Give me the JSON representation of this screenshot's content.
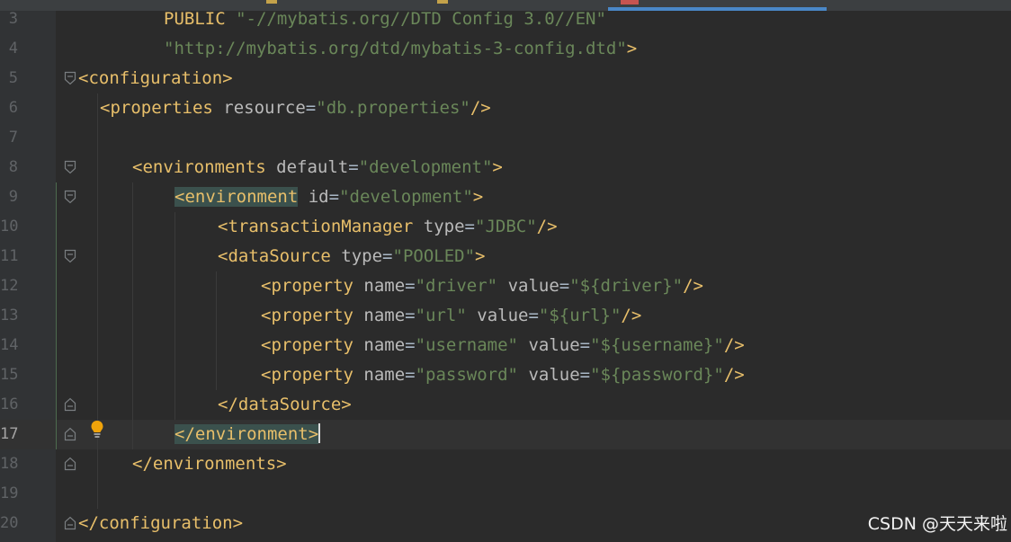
{
  "editor": {
    "current_line": 17,
    "lines": [
      {
        "num": "3",
        "tokens": [
          [
            "doc",
            "PUBLIC "
          ],
          [
            "str",
            "\"-//mybatis.org//DTD Config 3.0//EN\""
          ]
        ]
      },
      {
        "num": "4",
        "tokens": [
          [
            "str",
            "\"http://mybatis.org/dtd/mybatis-3-config.dtd\""
          ],
          [
            "tag",
            ">"
          ]
        ]
      },
      {
        "num": "5",
        "tokens": [
          [
            "tag",
            "<configuration>"
          ]
        ]
      },
      {
        "num": "6",
        "tokens": [
          [
            "tag",
            "<properties "
          ],
          [
            "attr",
            "resource"
          ],
          [
            "eq",
            "="
          ],
          [
            "val",
            "\"db.properties\""
          ],
          [
            "tag",
            "/>"
          ]
        ]
      },
      {
        "num": "7",
        "tokens": []
      },
      {
        "num": "8",
        "tokens": [
          [
            "tag",
            "<environments "
          ],
          [
            "attr",
            "default"
          ],
          [
            "eq",
            "="
          ],
          [
            "val",
            "\"development\""
          ],
          [
            "tag",
            ">"
          ]
        ]
      },
      {
        "num": "9",
        "tokens": [
          [
            "taghl",
            "<environment"
          ],
          [
            "tag",
            " "
          ],
          [
            "attr",
            "id"
          ],
          [
            "eq",
            "="
          ],
          [
            "val",
            "\"development\""
          ],
          [
            "tag",
            ">"
          ]
        ]
      },
      {
        "num": "10",
        "tokens": [
          [
            "tag",
            "<transactionManager "
          ],
          [
            "attr",
            "type"
          ],
          [
            "eq",
            "="
          ],
          [
            "val",
            "\"JDBC\""
          ],
          [
            "tag",
            "/>"
          ]
        ]
      },
      {
        "num": "11",
        "tokens": [
          [
            "tag",
            "<dataSource "
          ],
          [
            "attr",
            "type"
          ],
          [
            "eq",
            "="
          ],
          [
            "val",
            "\"POOLED\""
          ],
          [
            "tag",
            ">"
          ]
        ]
      },
      {
        "num": "12",
        "tokens": [
          [
            "tag",
            "<property "
          ],
          [
            "attr",
            "name"
          ],
          [
            "eq",
            "="
          ],
          [
            "val",
            "\"driver\""
          ],
          [
            "attr",
            " value"
          ],
          [
            "eq",
            "="
          ],
          [
            "val",
            "\"${driver}\""
          ],
          [
            "tag",
            "/>"
          ]
        ]
      },
      {
        "num": "13",
        "tokens": [
          [
            "tag",
            "<property "
          ],
          [
            "attr",
            "name"
          ],
          [
            "eq",
            "="
          ],
          [
            "val",
            "\"url\""
          ],
          [
            "attr",
            " value"
          ],
          [
            "eq",
            "="
          ],
          [
            "val",
            "\"${url}\""
          ],
          [
            "tag",
            "/>"
          ]
        ]
      },
      {
        "num": "14",
        "tokens": [
          [
            "tag",
            "<property "
          ],
          [
            "attr",
            "name"
          ],
          [
            "eq",
            "="
          ],
          [
            "val",
            "\"username\""
          ],
          [
            "attr",
            " value"
          ],
          [
            "eq",
            "="
          ],
          [
            "val",
            "\"${username}\""
          ],
          [
            "tag",
            "/>"
          ]
        ]
      },
      {
        "num": "15",
        "tokens": [
          [
            "tag",
            "<property "
          ],
          [
            "attr",
            "name"
          ],
          [
            "eq",
            "="
          ],
          [
            "val",
            "\"password\""
          ],
          [
            "attr",
            " value"
          ],
          [
            "eq",
            "="
          ],
          [
            "val",
            "\"${password}\""
          ],
          [
            "tag",
            "/>"
          ]
        ]
      },
      {
        "num": "16",
        "tokens": [
          [
            "tag",
            "</dataSource>"
          ]
        ]
      },
      {
        "num": "17",
        "tokens": [
          [
            "taghl",
            "</environment>"
          ]
        ]
      },
      {
        "num": "18",
        "tokens": [
          [
            "tag",
            "</environments>"
          ]
        ]
      },
      {
        "num": "19",
        "tokens": []
      },
      {
        "num": "20",
        "tokens": [
          [
            "tag",
            "</configuration>"
          ]
        ]
      }
    ]
  },
  "watermark": "CSDN @天天来啦",
  "icons": {
    "intention_bulb": "lightbulb-icon",
    "fold_open": "fold-open-icon",
    "fold_close": "fold-close-icon"
  },
  "colors": {
    "background": "#2b2b2b",
    "gutter": "#313335",
    "tag": "#e8bf6a",
    "attr": "#bababa",
    "value": "#6a8759",
    "active_tab_underline": "#4a88c7"
  }
}
